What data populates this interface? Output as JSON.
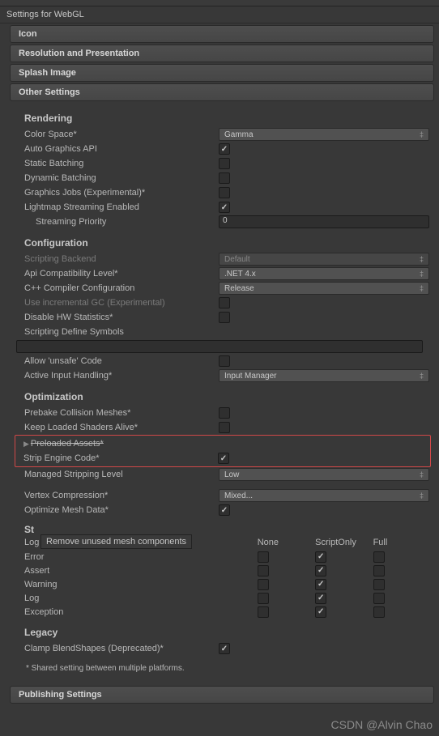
{
  "title": "Settings for WebGL",
  "sections": {
    "icon": "Icon",
    "resolution": "Resolution and Presentation",
    "splash": "Splash Image",
    "other": "Other Settings",
    "publishing": "Publishing Settings"
  },
  "rendering": {
    "title": "Rendering",
    "colorSpace": {
      "label": "Color Space*",
      "value": "Gamma"
    },
    "autoGraphicsAPI": {
      "label": "Auto Graphics API",
      "checked": true
    },
    "staticBatching": {
      "label": "Static Batching",
      "checked": false
    },
    "dynamicBatching": {
      "label": "Dynamic Batching",
      "checked": false
    },
    "graphicsJobs": {
      "label": "Graphics Jobs (Experimental)*",
      "checked": false
    },
    "lightmapStreaming": {
      "label": "Lightmap Streaming Enabled",
      "checked": true
    },
    "streamingPriority": {
      "label": "Streaming Priority",
      "value": "0"
    }
  },
  "configuration": {
    "title": "Configuration",
    "scriptingBackend": {
      "label": "Scripting Backend",
      "value": "Default"
    },
    "apiCompat": {
      "label": "Api Compatibility Level*",
      "value": ".NET 4.x"
    },
    "cppConfig": {
      "label": "C++ Compiler Configuration",
      "value": "Release"
    },
    "incrementalGC": {
      "label": "Use incremental GC (Experimental)",
      "checked": false
    },
    "disableHWStats": {
      "label": "Disable HW Statistics*",
      "checked": false
    },
    "scriptingDefine": {
      "label": "Scripting Define Symbols",
      "value": ""
    },
    "allowUnsafe": {
      "label": "Allow 'unsafe' Code",
      "checked": false
    },
    "activeInput": {
      "label": "Active Input Handling*",
      "value": "Input Manager"
    }
  },
  "optimization": {
    "title": "Optimization",
    "prebakeCollision": {
      "label": "Prebake Collision Meshes*",
      "checked": false
    },
    "keepLoadedShaders": {
      "label": "Keep Loaded Shaders Alive*",
      "checked": false
    },
    "preloadedAssets": {
      "label": "Preloaded Assets*"
    },
    "stripEngineCode": {
      "label": "Strip Engine Code*",
      "checked": true
    },
    "managedStripping": {
      "label": "Managed Stripping Level",
      "value": "Low"
    },
    "vertexCompression": {
      "label": "Vertex Compression*",
      "value": "Mixed..."
    },
    "optimizeMeshData": {
      "label": "Optimize Mesh Data*",
      "checked": true
    }
  },
  "tooltip": "Remove unused mesh components",
  "stackTrace": {
    "title": "Stack Trace*",
    "stLabel": "St",
    "headers": {
      "logType": "Log Type",
      "none": "None",
      "scriptOnly": "ScriptOnly",
      "full": "Full"
    },
    "rows": [
      {
        "name": "Error",
        "none": false,
        "scriptOnly": true,
        "full": false
      },
      {
        "name": "Assert",
        "none": false,
        "scriptOnly": true,
        "full": false
      },
      {
        "name": "Warning",
        "none": false,
        "scriptOnly": true,
        "full": false
      },
      {
        "name": "Log",
        "none": false,
        "scriptOnly": true,
        "full": false
      },
      {
        "name": "Exception",
        "none": false,
        "scriptOnly": true,
        "full": false
      }
    ]
  },
  "legacy": {
    "title": "Legacy",
    "clampBlend": {
      "label": "Clamp BlendShapes (Deprecated)*",
      "checked": true
    }
  },
  "footnote": "* Shared setting between multiple platforms.",
  "watermark": "CSDN @Alvin Chao"
}
